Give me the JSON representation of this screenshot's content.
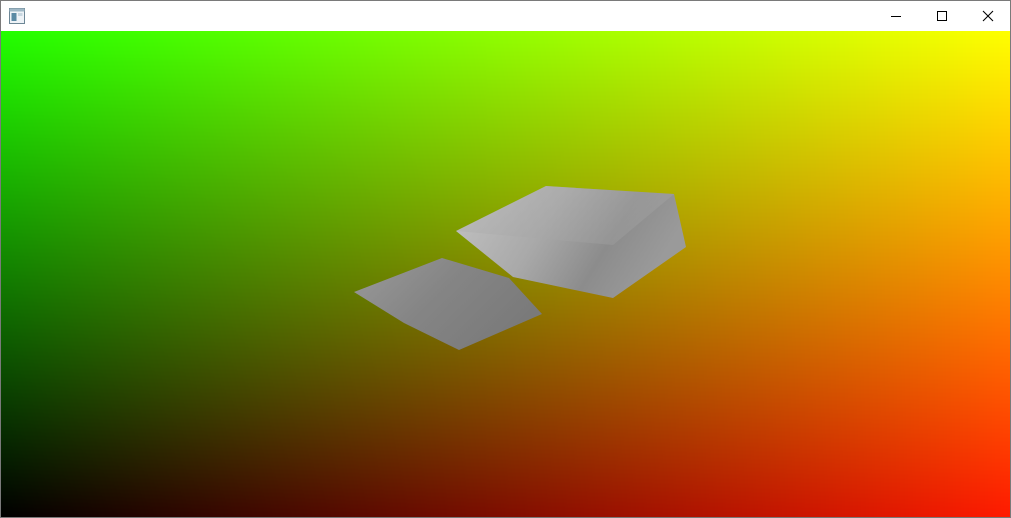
{
  "window": {
    "title": "",
    "icon": "window-app-icon",
    "controls": {
      "minimize_icon": "minimize-icon",
      "maximize_icon": "maximize-icon",
      "close_icon": "close-icon"
    }
  },
  "viewport": {
    "background_corners": {
      "top_left": "#22ff00",
      "top_right": "#ffff00",
      "bottom_left": "#000000",
      "bottom_right": "#ff1a00"
    },
    "shape_color": "#9a9a9a",
    "shapes": [
      "shaded-quad-upper",
      "shaded-quad-lower"
    ]
  }
}
